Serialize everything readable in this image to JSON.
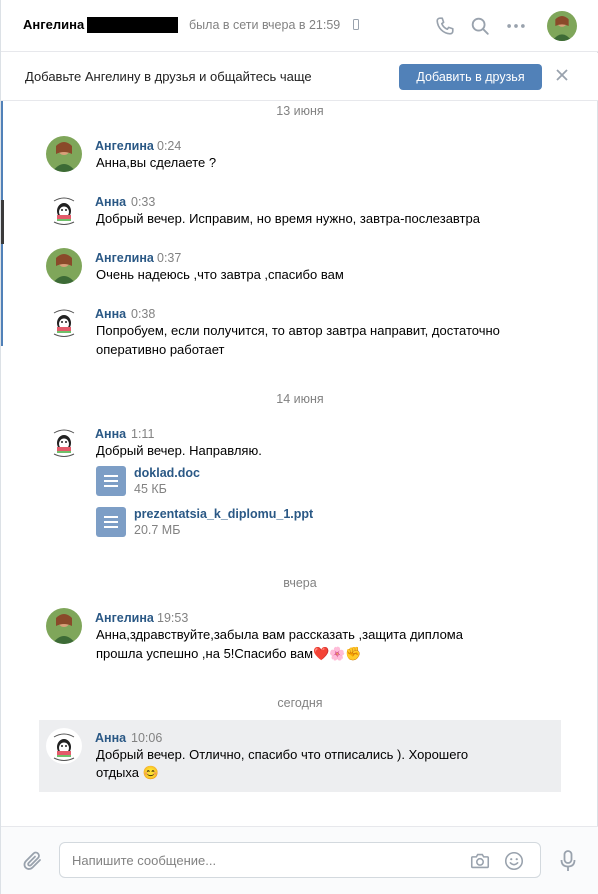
{
  "header": {
    "contact_name": "Ангелина",
    "status": "была в сети вчера в 21:59"
  },
  "banner": {
    "text": "Добавьте Ангелину в друзья и общайтесь чаще",
    "button_label": "Добавить в друзья"
  },
  "chat": {
    "dates": [
      "13 июня",
      "14 июня",
      "вчера",
      "сегодня"
    ],
    "messages": [
      {
        "author": "Ангелина",
        "time": "0:24",
        "lines": [
          "Анна,вы сделаете ?"
        ]
      },
      {
        "author": "Анна",
        "time": "0:33",
        "lines": [
          "Добрый вечер. Исправим, но время нужно, завтра-послезавтра"
        ]
      },
      {
        "author": "Ангелина",
        "time": "0:37",
        "lines": [
          "Очень надеюсь ,что завтра ,спасибо вам"
        ]
      },
      {
        "author": "Анна",
        "time": "0:38",
        "lines": [
          "Попробуем, если получится, то автор завтра направит, достаточно",
          "оперативно работает"
        ]
      },
      {
        "author": "Анна",
        "time": "1:11",
        "lines": [
          "Добрый вечер. Направляю."
        ],
        "attachments": [
          {
            "name": "doklad.doc",
            "size": "45 КБ"
          },
          {
            "name": "prezentatsia_k_diplomu_1.ppt",
            "size": "20.7 МБ"
          }
        ]
      },
      {
        "author": "Ангелина",
        "time": "19:53",
        "lines": [
          "Анна,здравствуйте,забыла вам рассказать ,защита диплома",
          "прошла успешно ,на 5!Спасибо вам"
        ],
        "emoji": [
          "❤️",
          "🌸",
          "✊"
        ]
      },
      {
        "author": "Анна",
        "time": "10:06",
        "lines": [
          "Добрый вечер. Отлично, спасибо что отписались ). Хорошего",
          "отдыха"
        ],
        "emoji": [
          "😊"
        ]
      }
    ]
  },
  "composer": {
    "placeholder": "Напишите сообщение..."
  },
  "colors": {
    "accent": "#5181b8",
    "author_link": "#2a5885",
    "muted": "#828282",
    "highlight": "#edeef0"
  },
  "icons": [
    "phone-icon",
    "search-icon",
    "more-icon",
    "close-icon",
    "document-icon",
    "attach-icon",
    "camera-icon",
    "smile-icon",
    "microphone-icon"
  ]
}
